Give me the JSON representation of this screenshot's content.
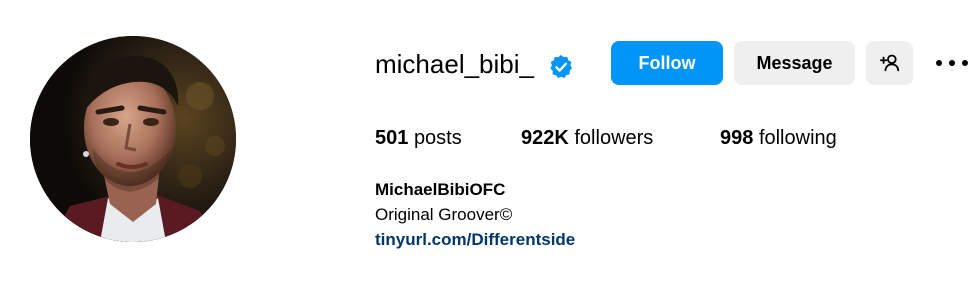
{
  "profile": {
    "username": "michael_bibi_",
    "verified": true,
    "full_name": "MichaelBibiOFC",
    "bio": "Original Groover©",
    "link": "tinyurl.com/Differentside"
  },
  "actions": {
    "follow_label": "Follow",
    "message_label": "Message",
    "add_user_icon": "person-plus-icon",
    "more_icon": "more-options-icon"
  },
  "stats": {
    "posts_count": "501",
    "posts_label": "posts",
    "followers_count": "922K",
    "followers_label": "followers",
    "following_count": "998",
    "following_label": "following"
  },
  "colors": {
    "follow_button": "#0095f6",
    "secondary_button": "#efefef",
    "verified_badge": "#0095f6",
    "link": "#00376b"
  }
}
